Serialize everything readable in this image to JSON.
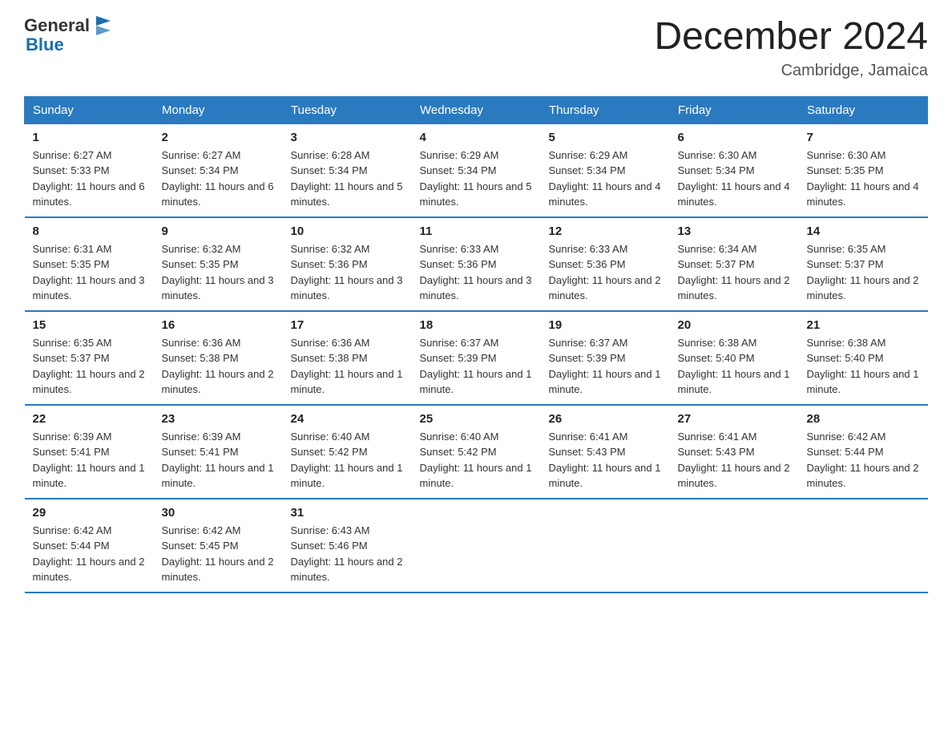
{
  "logo": {
    "text_general": "General",
    "text_blue": "Blue"
  },
  "title": "December 2024",
  "location": "Cambridge, Jamaica",
  "days_of_week": [
    "Sunday",
    "Monday",
    "Tuesday",
    "Wednesday",
    "Thursday",
    "Friday",
    "Saturday"
  ],
  "weeks": [
    [
      {
        "day": "1",
        "sunrise": "6:27 AM",
        "sunset": "5:33 PM",
        "daylight": "11 hours and 6 minutes."
      },
      {
        "day": "2",
        "sunrise": "6:27 AM",
        "sunset": "5:34 PM",
        "daylight": "11 hours and 6 minutes."
      },
      {
        "day": "3",
        "sunrise": "6:28 AM",
        "sunset": "5:34 PM",
        "daylight": "11 hours and 5 minutes."
      },
      {
        "day": "4",
        "sunrise": "6:29 AM",
        "sunset": "5:34 PM",
        "daylight": "11 hours and 5 minutes."
      },
      {
        "day": "5",
        "sunrise": "6:29 AM",
        "sunset": "5:34 PM",
        "daylight": "11 hours and 4 minutes."
      },
      {
        "day": "6",
        "sunrise": "6:30 AM",
        "sunset": "5:34 PM",
        "daylight": "11 hours and 4 minutes."
      },
      {
        "day": "7",
        "sunrise": "6:30 AM",
        "sunset": "5:35 PM",
        "daylight": "11 hours and 4 minutes."
      }
    ],
    [
      {
        "day": "8",
        "sunrise": "6:31 AM",
        "sunset": "5:35 PM",
        "daylight": "11 hours and 3 minutes."
      },
      {
        "day": "9",
        "sunrise": "6:32 AM",
        "sunset": "5:35 PM",
        "daylight": "11 hours and 3 minutes."
      },
      {
        "day": "10",
        "sunrise": "6:32 AM",
        "sunset": "5:36 PM",
        "daylight": "11 hours and 3 minutes."
      },
      {
        "day": "11",
        "sunrise": "6:33 AM",
        "sunset": "5:36 PM",
        "daylight": "11 hours and 3 minutes."
      },
      {
        "day": "12",
        "sunrise": "6:33 AM",
        "sunset": "5:36 PM",
        "daylight": "11 hours and 2 minutes."
      },
      {
        "day": "13",
        "sunrise": "6:34 AM",
        "sunset": "5:37 PM",
        "daylight": "11 hours and 2 minutes."
      },
      {
        "day": "14",
        "sunrise": "6:35 AM",
        "sunset": "5:37 PM",
        "daylight": "11 hours and 2 minutes."
      }
    ],
    [
      {
        "day": "15",
        "sunrise": "6:35 AM",
        "sunset": "5:37 PM",
        "daylight": "11 hours and 2 minutes."
      },
      {
        "day": "16",
        "sunrise": "6:36 AM",
        "sunset": "5:38 PM",
        "daylight": "11 hours and 2 minutes."
      },
      {
        "day": "17",
        "sunrise": "6:36 AM",
        "sunset": "5:38 PM",
        "daylight": "11 hours and 1 minute."
      },
      {
        "day": "18",
        "sunrise": "6:37 AM",
        "sunset": "5:39 PM",
        "daylight": "11 hours and 1 minute."
      },
      {
        "day": "19",
        "sunrise": "6:37 AM",
        "sunset": "5:39 PM",
        "daylight": "11 hours and 1 minute."
      },
      {
        "day": "20",
        "sunrise": "6:38 AM",
        "sunset": "5:40 PM",
        "daylight": "11 hours and 1 minute."
      },
      {
        "day": "21",
        "sunrise": "6:38 AM",
        "sunset": "5:40 PM",
        "daylight": "11 hours and 1 minute."
      }
    ],
    [
      {
        "day": "22",
        "sunrise": "6:39 AM",
        "sunset": "5:41 PM",
        "daylight": "11 hours and 1 minute."
      },
      {
        "day": "23",
        "sunrise": "6:39 AM",
        "sunset": "5:41 PM",
        "daylight": "11 hours and 1 minute."
      },
      {
        "day": "24",
        "sunrise": "6:40 AM",
        "sunset": "5:42 PM",
        "daylight": "11 hours and 1 minute."
      },
      {
        "day": "25",
        "sunrise": "6:40 AM",
        "sunset": "5:42 PM",
        "daylight": "11 hours and 1 minute."
      },
      {
        "day": "26",
        "sunrise": "6:41 AM",
        "sunset": "5:43 PM",
        "daylight": "11 hours and 1 minute."
      },
      {
        "day": "27",
        "sunrise": "6:41 AM",
        "sunset": "5:43 PM",
        "daylight": "11 hours and 2 minutes."
      },
      {
        "day": "28",
        "sunrise": "6:42 AM",
        "sunset": "5:44 PM",
        "daylight": "11 hours and 2 minutes."
      }
    ],
    [
      {
        "day": "29",
        "sunrise": "6:42 AM",
        "sunset": "5:44 PM",
        "daylight": "11 hours and 2 minutes."
      },
      {
        "day": "30",
        "sunrise": "6:42 AM",
        "sunset": "5:45 PM",
        "daylight": "11 hours and 2 minutes."
      },
      {
        "day": "31",
        "sunrise": "6:43 AM",
        "sunset": "5:46 PM",
        "daylight": "11 hours and 2 minutes."
      },
      null,
      null,
      null,
      null
    ]
  ],
  "labels": {
    "sunrise": "Sunrise:",
    "sunset": "Sunset:",
    "daylight": "Daylight:"
  }
}
